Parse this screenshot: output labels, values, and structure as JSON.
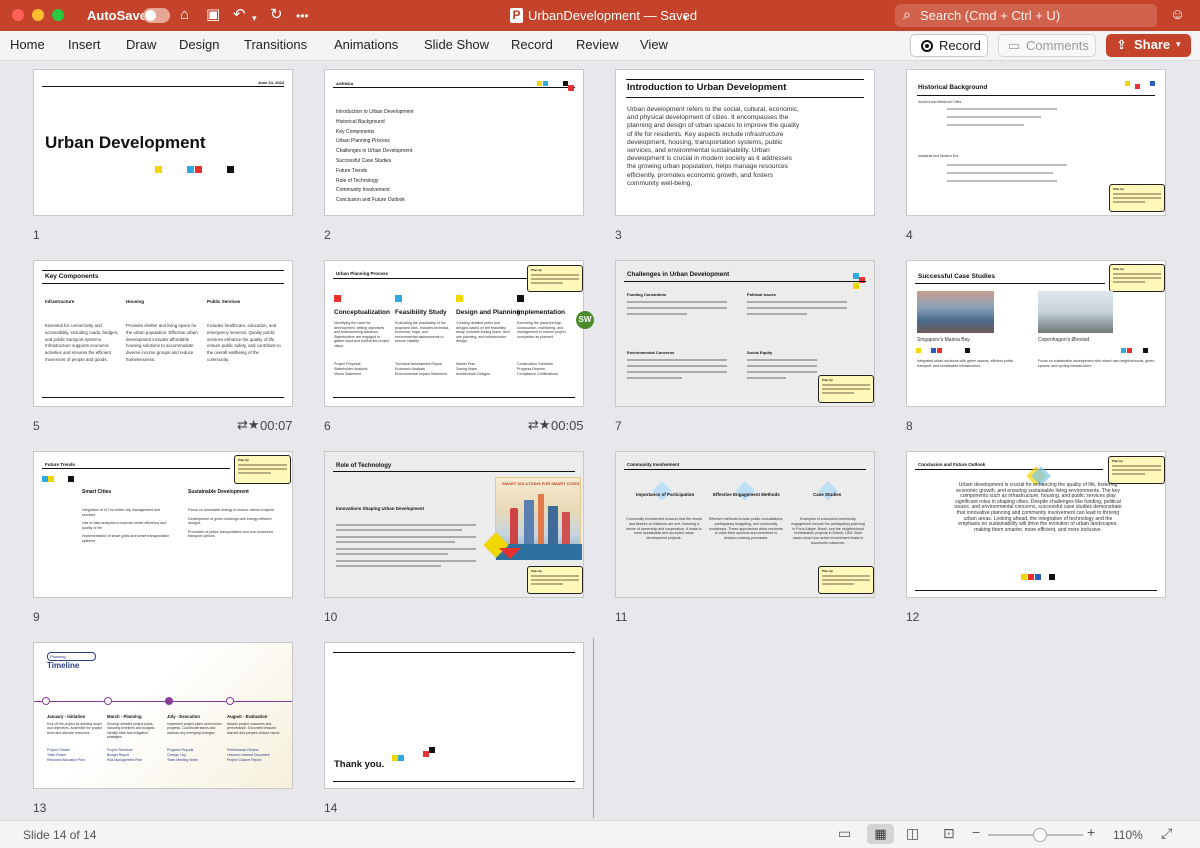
{
  "window": {
    "autosave_label": "AutoSave",
    "title": "UrbanDevelopment — Saved",
    "search_placeholder": "Search (Cmd + Ctrl + U)"
  },
  "ribbon": {
    "tabs": [
      "Home",
      "Insert",
      "Draw",
      "Design",
      "Transitions",
      "Animations",
      "Slide Show",
      "Record",
      "Review",
      "View"
    ],
    "record_label": "Record",
    "comments_label": "Comments",
    "share_label": "Share"
  },
  "slides": [
    {
      "number": "1",
      "date": "June 24, 2024",
      "title": "Urban Development"
    },
    {
      "number": "2",
      "header": "AGENDA",
      "items": [
        "Introduction to Urban Development",
        "Historical Background",
        "Key Components",
        "Urban Planning Process",
        "Challenges in Urban Development",
        "Successful Case Studies",
        "Future Trends",
        "Role of Technology",
        "Community Involvement",
        "Conclusion and Future Outlook"
      ]
    },
    {
      "number": "3",
      "title": "Introduction to Urban Development",
      "body": "Urban development refers to the social, cultural, economic, and physical development of cities. It encompasses the planning and design of urban spaces to improve the quality of life for residents. Key aspects include infrastructure development, housing, transportation systems, public services, and environmental sustainability. Urban development is crucial in modern society as it addresses the growing urban population, helps manage resources efficiently, promotes economic growth, and fosters community well-being."
    },
    {
      "number": "4",
      "title": "Historical Background",
      "sub1": "Ancient and Medieval Cities",
      "sub2": "Industrial and Modern Era"
    },
    {
      "number": "5",
      "title": "Key Components",
      "columns": [
        {
          "heading": "Infrastructure",
          "text": "Essential for connectivity and accessibility, including roads, bridges, and public transport systems. Infrastructure supports economic activities and ensures the efficient movement of people and goods."
        },
        {
          "heading": "Housing",
          "text": "Provides shelter and living space for the urban population. Effective urban development includes affordable housing solutions to accommodate diverse income groups and reduce homelessness."
        },
        {
          "heading": "Public Services",
          "text": "Includes healthcare, education, and emergency services. Quality public services enhance the quality of life, ensure public safety, and contribute to the overall wellbeing of the community."
        }
      ],
      "timing": "00:07"
    },
    {
      "number": "6",
      "title": "Urban Planning Process",
      "columns": [
        {
          "heading": "Conceptualization",
          "text": "Identifying the need for development, setting objectives and brainstorming solutions. Stakeholders are engaged to gather input and outline the project vision.",
          "items": [
            "Project Proposal",
            "Stakeholder Analysis",
            "Vision Statement"
          ]
        },
        {
          "heading": "Feasibility Study",
          "text": "Evaluating the practicality of the proposed plan. Includes technical, economic, legal, and environmental assessments to ensure viability.",
          "items": [
            "Technical Assessment Report",
            "Economic Analysis",
            "Environmental Impact Statement"
          ]
        },
        {
          "heading": "Design and Planning",
          "text": "Creating detailed plans and designs based on the feasibility study. Includes zoning plans, land use planning, and infrastructure design.",
          "items": [
            "Master Plan",
            "Zoning Maps",
            "Architectural Designs"
          ]
        },
        {
          "heading": "Implementation",
          "text": "Executing the plans through construction, monitoring, and management to ensure project completion as planned.",
          "items": [
            "Construction Schedule",
            "Progress Reports",
            "Compliance Certifications"
          ]
        }
      ],
      "avatar": "SW",
      "timing": "00:05"
    },
    {
      "number": "7",
      "title": "Challenges in Urban Development",
      "headings": [
        "Funding Constraints",
        "Political Issues",
        "Environmental Concerns",
        "Social Equity"
      ]
    },
    {
      "number": "8",
      "title": "Successful Case Studies",
      "cap1": "Singapore's Marina Bay",
      "cap2": "Copenhagen's Ørestad",
      "text1": "Integrated urban solutions with green spaces, efficient public transport, and sustainable infrastructure.",
      "text2": "Focus on sustainable development with mixed-use neighborhoods, green spaces, and cycling infrastructure."
    },
    {
      "number": "9",
      "title": "Future Trends",
      "col1": "Smart Cities",
      "col2": "Sustainable Development",
      "bul1": [
        "Integration of IoT for better city management and services",
        "Use of data analytics to improve urban efficiency and quality of life",
        "Implementation of smart grids and smart transportation systems"
      ],
      "bul2": [
        "Focus on renewable energy to reduce carbon footprint",
        "Development of green buildings with energy-efficient designs",
        "Promotion of public transportation and non-motorized transport options"
      ]
    },
    {
      "number": "10",
      "title": "Role of Technology",
      "subtitle": "Innovations Shaping Urban Development",
      "image_caption": "SMART SOLUTIONS FOR SMART CITIES"
    },
    {
      "number": "11",
      "title": "Community Involvement",
      "headings": [
        "Importance of Participation",
        "Effective Engagement Methods",
        "Case Studies"
      ],
      "texts": [
        "Community involvement ensures that the needs and desires of residents are met, fostering a sense of ownership and cooperation. It leads to more sustainable and accepted urban development projects.",
        "Effective methods include public consultations, participatory budgeting, and community workshops. These approaches allow residents to voice their opinions and contribute to decision-making processes.",
        "Examples of successful community engagement include the participatory planning in Porto Alegre, Brazil, and the neighborhood revitalization projects in Detroit, USA. Both cases show how active involvement leads to successful outcomes."
      ]
    },
    {
      "number": "12",
      "title": "Conclusion and Future Outlook",
      "body": "Urban development is crucial for enhancing the quality of life, fostering economic growth, and ensuring sustainable living environments. The key components such as infrastructure, housing, and public services play significant roles in shaping cities. Despite challenges like funding, political issues, and environmental concerns, successful case studies demonstrate that innovative planning and community involvement can lead to thriving urban areas. Looking ahead, the integration of technology and the emphasis on sustainability will drive the evolution of urban landscapes, making them smarter, more efficient, and more inclusive."
    },
    {
      "number": "13",
      "tag": "Planning",
      "title": "Timeline",
      "phases": [
        {
          "heading": "January - Initiation",
          "text": "Kick off the project by defining scope and objectives. Assemble the project team and allocate resources.",
          "items": [
            "Project Charter",
            "Team Roster",
            "Resource Allocation Plan"
          ]
        },
        {
          "heading": "March - Planning",
          "text": "Develop detailed project plans, including timelines and budgets. Identify risks and mitigation strategies.",
          "items": [
            "Project Schedule",
            "Budget Report",
            "Risk Management Plan"
          ]
        },
        {
          "heading": "July - Execution",
          "text": "Implement project plans and monitor progress. Coordinate teams and address any emerging changes.",
          "items": [
            "Progress Reports",
            "Change Log",
            "Team Meeting Notes"
          ]
        },
        {
          "heading": "August - Evaluation",
          "text": "Assess project outcomes and performance. Document lessons learned and prepare closure report.",
          "items": [
            "Performance Review",
            "Lessons Learned Document",
            "Project Closure Report"
          ]
        }
      ]
    },
    {
      "number": "14",
      "title": "Thank you."
    }
  ],
  "note_label": "Plan tip",
  "statusbar": {
    "slide_info": "Slide 14 of 14",
    "zoom": "110%",
    "zoom_level": 0.55
  }
}
